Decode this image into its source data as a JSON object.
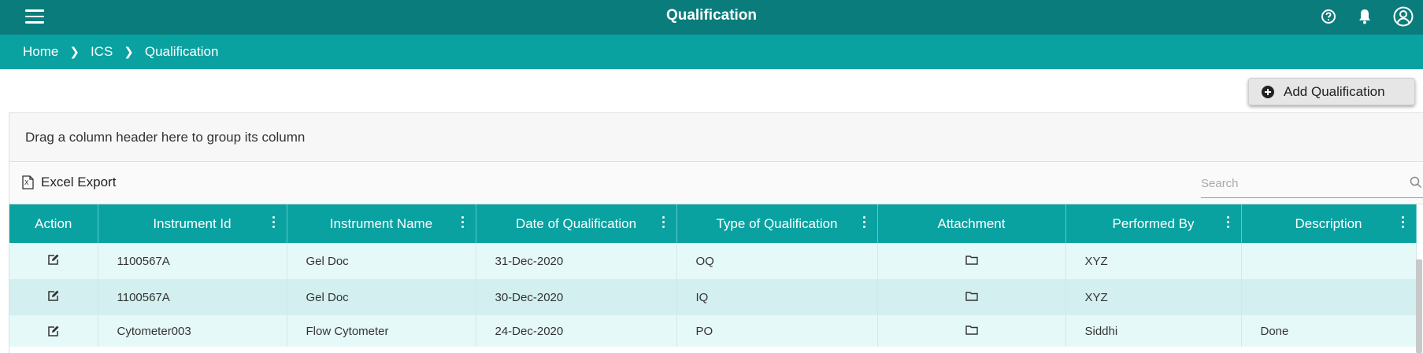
{
  "header": {
    "title": "Qualification"
  },
  "breadcrumb": [
    "Home",
    "ICS",
    "Qualification"
  ],
  "add_button": {
    "label": "Add Qualification"
  },
  "group_panel": {
    "text": "Drag a column header here to group its column"
  },
  "toolbar": {
    "excel_label": "Excel Export",
    "search_placeholder": "Search"
  },
  "columns": [
    "Action",
    "Instrument Id",
    "Instrument Name",
    "Date of Qualification",
    "Type of Qualification",
    "Attachment",
    "Performed By",
    "Description"
  ],
  "rows": [
    {
      "instrument_id": "1100567A",
      "instrument_name": "Gel Doc",
      "date": "31-Dec-2020",
      "type": "OQ",
      "performed_by": "XYZ",
      "description": ""
    },
    {
      "instrument_id": "1100567A",
      "instrument_name": "Gel Doc",
      "date": "30-Dec-2020",
      "type": "IQ",
      "performed_by": "XYZ",
      "description": ""
    },
    {
      "instrument_id": "Cytometer003",
      "instrument_name": "Flow Cytometer",
      "date": "24-Dec-2020",
      "type": "PO",
      "performed_by": "Siddhi",
      "description": "Done"
    }
  ],
  "colors": {
    "topbar": "#0a7c7c",
    "accent": "#0aa1a1",
    "row_odd": "#e6f9f9",
    "row_even": "#d3efef"
  }
}
